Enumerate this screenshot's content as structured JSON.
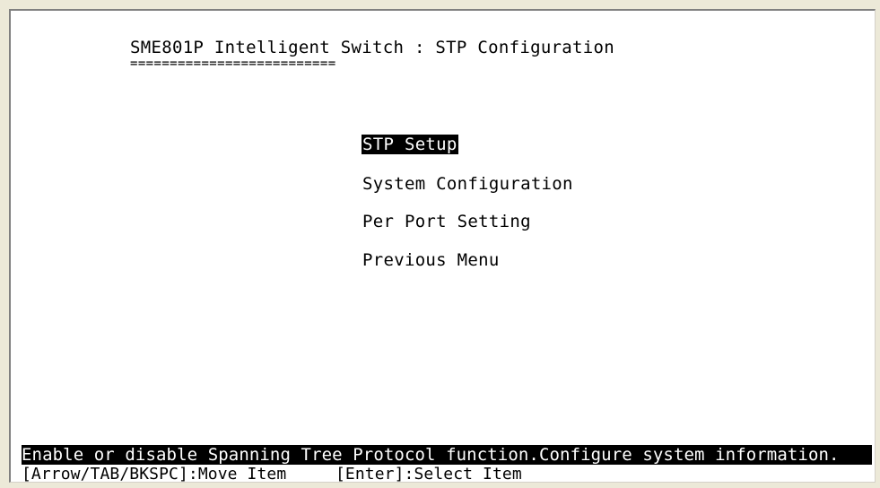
{
  "terminal": {
    "title": "SME801P Intelligent Switch : STP Configuration",
    "title_underline": "=========================="
  },
  "menu": {
    "items": [
      {
        "label": "STP Setup",
        "selected": true
      },
      {
        "label": "System Configuration",
        "selected": false
      },
      {
        "label": "Per Port Setting",
        "selected": false
      },
      {
        "label": "Previous Menu",
        "selected": false
      }
    ]
  },
  "status": {
    "message": "Enable or disable Spanning Tree Protocol function.Configure system information.",
    "keys": "[Arrow/TAB/BKSPC]:Move Item     [Enter]:Select Item"
  },
  "colors": {
    "background": "#ffffff",
    "text": "#000000",
    "highlight_bg": "#000000",
    "highlight_fg": "#ffffff"
  }
}
